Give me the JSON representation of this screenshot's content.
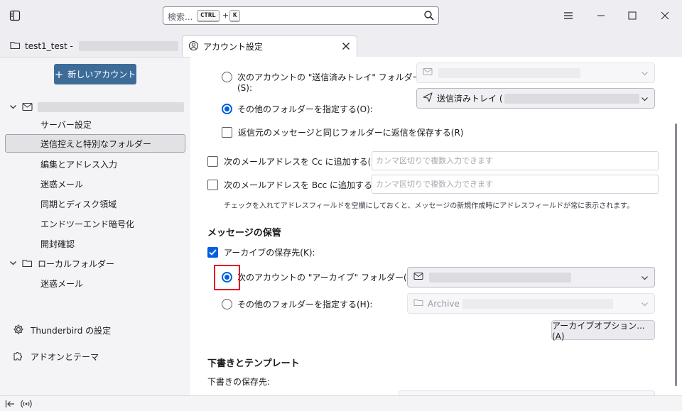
{
  "titlebar": {
    "search_placeholder": "検索...",
    "shortcut_ctrl": "CTRL",
    "shortcut_plus": "+",
    "shortcut_key": "K"
  },
  "tabs": [
    {
      "label": "test1_test -",
      "icon": "folder-icon"
    },
    {
      "label": "アカウント設定",
      "icon": "account-settings-icon"
    }
  ],
  "sidebar": {
    "new_account": "新しいアカウント",
    "account_items": [
      "サーバー設定",
      "送信控えと特別なフォルダー",
      "編集とアドレス入力",
      "迷惑メール",
      "同期とディスク領域",
      "エンドツーエンド暗号化",
      "開封確認"
    ],
    "local_folders": "ローカルフォルダー",
    "local_items": [
      "迷惑メール"
    ],
    "settings_label": "Thunderbird の設定",
    "addons_label": "アドオンとテーマ"
  },
  "sent": {
    "radio_account_label": "次のアカウントの \"送信済みトレイ\" フォルダー",
    "radio_account_key": "(S):",
    "radio_other_label": "その他のフォルダーを指定する(O):",
    "selected_folder": "送信済みトレイ (",
    "reply_same_folder": "返信元のメッセージと同じフォルダーに返信を保存する(R)"
  },
  "address": {
    "cc_label": "次のメールアドレスを Cc に追加する(C):",
    "bcc_label": "次のメールアドレスを Bcc に追加する(B):",
    "cc_placeholder": "カンマ区切りで複数入力できます",
    "bcc_placeholder": "カンマ区切りで複数入力できます",
    "hint": "チェックを入れてアドレスフィールドを空欄にしておくと、メッセージの新規作成時にアドレスフィールドが常に表示されます。"
  },
  "archive": {
    "section_title": "メッセージの保管",
    "archive_label": "アーカイブの保存先(K):",
    "radio_account_label": "次のアカウントの \"アーカイブ\" フォルダー(N):",
    "radio_other_label": "その他のフォルダーを指定する(H):",
    "other_folder": "Archive",
    "options_button": "アーカイブオプション...(A)"
  },
  "drafts": {
    "section_title": "下書きとテンプレート",
    "save_label": "下書きの保存先:"
  },
  "colors": {
    "accent": "#0060df",
    "new_account_button": "#3d6c99",
    "highlight": "#e01b24"
  }
}
